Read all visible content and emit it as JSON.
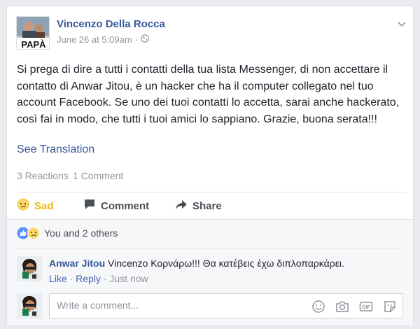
{
  "post": {
    "author": "Vincenzo Della Rocca",
    "timestamp": "June 26 at 5:09am",
    "separator": "·",
    "privacy_icon": "globe-icon",
    "text": "Si prega di dire a tutti i contatti della tua lista Messenger, di non accettare il contatto di Anwar Jitou, è un hacker che ha il computer collegato nel tuo account Facebook. Se uno dei tuoi contatti lo accetta, sarai anche hackerato, così fai in modo, che tutti i tuoi amici lo sappiano. Grazie, buona serata!!!",
    "see_translation": "See Translation",
    "reactions_count": "3 Reactions",
    "comments_count": "1 Comment",
    "avatar_text": "PAPÀ"
  },
  "actions": {
    "sad": "Sad",
    "comment": "Comment",
    "share": "Share"
  },
  "reactions_summary": {
    "text": "You and 2 others"
  },
  "comment": {
    "author": "Anwar Jitou",
    "text": "Vincenzo Κορνάρω!!! Θα κατέβεις έχω διπλοπαρκάρει.",
    "like": "Like",
    "reply": "Reply",
    "dot": "·",
    "time": "Just now"
  },
  "composer": {
    "placeholder": "Write a comment..."
  },
  "colors": {
    "link": "#365899",
    "sad_yellow": "#f0ba15",
    "like_blue": "#5890ff",
    "meta_gray": "#90949c"
  }
}
